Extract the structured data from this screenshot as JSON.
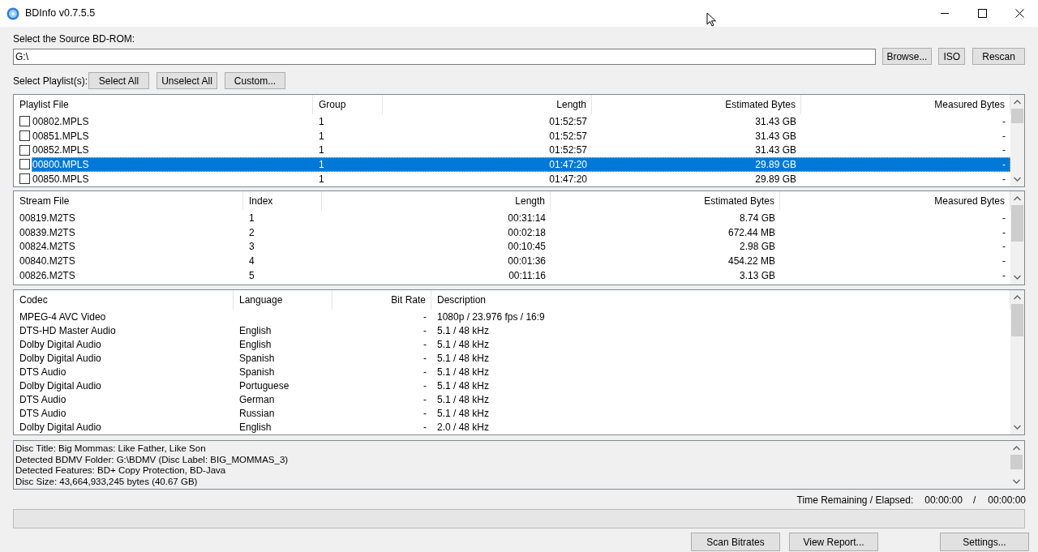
{
  "window": {
    "title": "BDInfo v0.7.5.5"
  },
  "source": {
    "label": "Select the Source BD-ROM:",
    "value": "G:\\",
    "buttons": [
      "Browse...",
      "ISO",
      "Rescan"
    ]
  },
  "playlist_select": {
    "label": "Select Playlist(s):",
    "buttons": [
      "Select All",
      "Unselect All",
      "Custom..."
    ]
  },
  "playlists": {
    "columns": [
      "Playlist File",
      "Group",
      "Length",
      "Estimated Bytes",
      "Measured Bytes"
    ],
    "rows": [
      {
        "cells": [
          "00802.MPLS",
          "1",
          "01:52:57",
          "31.43 GB",
          "-"
        ],
        "checked": false,
        "selected": false
      },
      {
        "cells": [
          "00851.MPLS",
          "1",
          "01:52:57",
          "31.43 GB",
          "-"
        ],
        "checked": false,
        "selected": false
      },
      {
        "cells": [
          "00852.MPLS",
          "1",
          "01:52:57",
          "31.43 GB",
          "-"
        ],
        "checked": false,
        "selected": false
      },
      {
        "cells": [
          "00800.MPLS",
          "1",
          "01:47:20",
          "29.89 GB",
          "-"
        ],
        "checked": false,
        "selected": true
      },
      {
        "cells": [
          "00850.MPLS",
          "1",
          "01:47:20",
          "29.89 GB",
          "-"
        ],
        "checked": false,
        "selected": false
      }
    ]
  },
  "streams": {
    "columns": [
      "Stream File",
      "Index",
      "Length",
      "Estimated Bytes",
      "Measured Bytes"
    ],
    "rows": [
      [
        "00819.M2TS",
        "1",
        "00:31:14",
        "8.74 GB",
        "-"
      ],
      [
        "00839.M2TS",
        "2",
        "00:02:18",
        "672.44 MB",
        "-"
      ],
      [
        "00824.M2TS",
        "3",
        "00:10:45",
        "2.98 GB",
        "-"
      ],
      [
        "00840.M2TS",
        "4",
        "00:01:36",
        "454.22 MB",
        "-"
      ],
      [
        "00826.M2TS",
        "5",
        "00:11:16",
        "3.13 GB",
        "-"
      ]
    ]
  },
  "codecs": {
    "columns": [
      "Codec",
      "Language",
      "Bit Rate",
      "Description"
    ],
    "rows": [
      [
        "MPEG-4 AVC Video",
        "",
        "-",
        "1080p / 23.976 fps / 16:9"
      ],
      [
        "DTS-HD Master Audio",
        "English",
        "-",
        "5.1 / 48 kHz"
      ],
      [
        "Dolby Digital Audio",
        "English",
        "-",
        "5.1 / 48 kHz"
      ],
      [
        "Dolby Digital Audio",
        "Spanish",
        "-",
        "5.1 / 48 kHz"
      ],
      [
        "DTS Audio",
        "Spanish",
        "-",
        "5.1 / 48 kHz"
      ],
      [
        "Dolby Digital Audio",
        "Portuguese",
        "-",
        "5.1 / 48 kHz"
      ],
      [
        "DTS Audio",
        "German",
        "-",
        "5.1 / 48 kHz"
      ],
      [
        "DTS Audio",
        "Russian",
        "-",
        "5.1 / 48 kHz"
      ],
      [
        "Dolby Digital Audio",
        "English",
        "-",
        "2.0 / 48 kHz"
      ]
    ]
  },
  "disc_info": [
    "Disc Title: Big Mommas: Like Father, Like Son",
    "Detected BDMV Folder: G:\\BDMV (Disc Label: BIG_MOMMAS_3)",
    "Detected Features: BD+ Copy Protection, BD-Java",
    "Disc Size: 43,664,933,245 bytes (40.67 GB)"
  ],
  "time": {
    "label": "Time Remaining / Elapsed:",
    "remaining": "00:00:00",
    "separator": "/",
    "elapsed": "00:00:00"
  },
  "progress": {
    "level": 0
  },
  "buttons": [
    "Scan Bitrates",
    "View Report...",
    "Settings..."
  ]
}
